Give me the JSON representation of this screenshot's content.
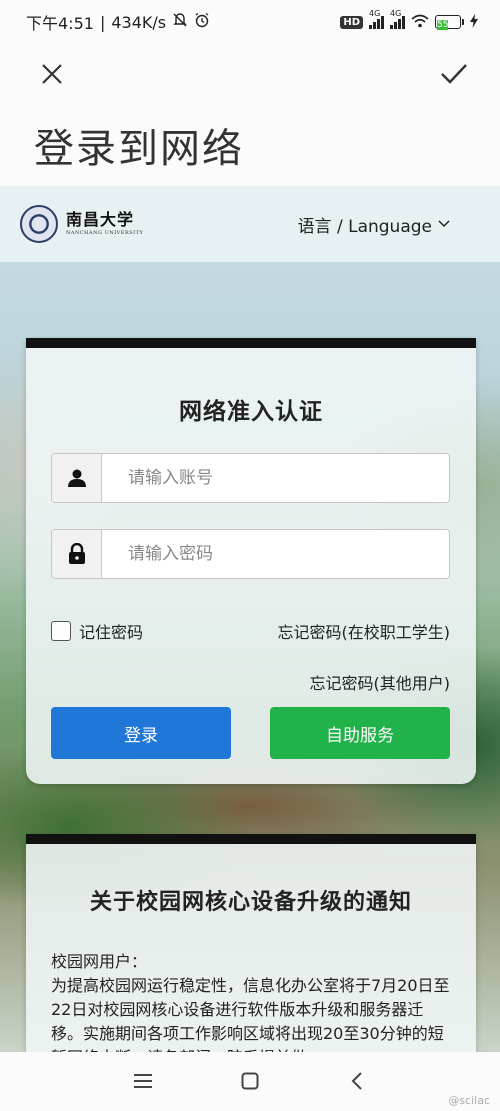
{
  "status_bar": {
    "time": "下午4:51",
    "separator": "|",
    "speed": "434K/s",
    "hd": "HD",
    "net1": "4G",
    "net2": "4G",
    "battery": "55"
  },
  "dialog": {
    "title": "登录到网络"
  },
  "site": {
    "logo_cn": "南昌大学",
    "logo_en": "NANCHANG UNIVERSITY",
    "language_label": "语言 / Language"
  },
  "login": {
    "title": "网络准入认证",
    "account_placeholder": "请输入账号",
    "password_placeholder": "请输入密码",
    "remember_label": "记住密码",
    "forgot_staff": "忘记密码(在校职工学生)",
    "forgot_other": "忘记密码(其他用户)",
    "login_button": "登录",
    "self_service_button": "自助服务"
  },
  "notice": {
    "title": "关于校园网核心设备升级的通知",
    "greeting": "校园网用户：",
    "body": "为提高校园网运行稳定性，信息化办公室将于7月20日至22日对校园网核心设备进行软件版本升级和服务器迁移。实施期间各项工作影响区域将出现20至30分钟的短暂网络中断，请各部门、院系提前做"
  },
  "watermark": "@scilac",
  "colors": {
    "login_button": "#1f78d8",
    "self_service_button": "#22b24a",
    "card_top_border": "#111111"
  }
}
